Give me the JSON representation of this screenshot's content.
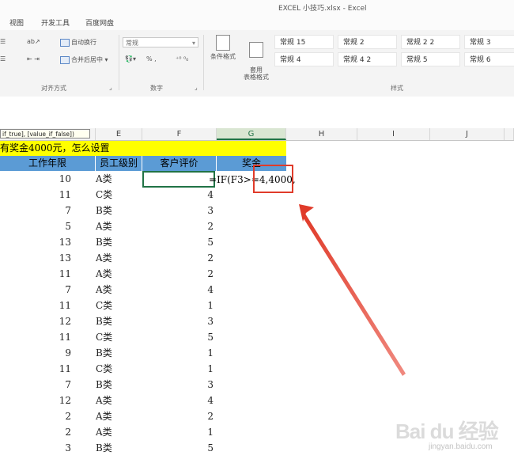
{
  "window": {
    "title": "EXCEL 小技巧.xlsx - Excel"
  },
  "menu": {
    "items": [
      "视图",
      "开发工具",
      "百度网盘"
    ]
  },
  "ribbon": {
    "wrap_text": "自动换行",
    "merge_center": "合并后居中",
    "number_format": "常规",
    "number_symbols": "% ,",
    "conditional_format": "条件格式",
    "format_as_table": "套用\n表格格式",
    "groups": {
      "alignment": "对齐方式",
      "number": "数字",
      "styles": "样式"
    },
    "styles": [
      "常规 15",
      "常规 2",
      "常规 2 2",
      "常规 3",
      "常规 4",
      "常规 4 2",
      "常规 5",
      "常规 6"
    ]
  },
  "tooltip": {
    "text": "if_true], [value_if_false])"
  },
  "columns": [
    "E",
    "F",
    "G",
    "H",
    "I",
    "J"
  ],
  "sheet": {
    "title": "有奖金4000元，怎么设置",
    "headers": [
      "工作年限",
      "员工级别",
      "客户评价",
      "奖金"
    ],
    "formula": "=IF(F3>=4,4000,",
    "rows": [
      {
        "years": "10",
        "level": "A类",
        "rating": ""
      },
      {
        "years": "11",
        "level": "C类",
        "rating": "4"
      },
      {
        "years": "7",
        "level": "B类",
        "rating": "3"
      },
      {
        "years": "5",
        "level": "A类",
        "rating": "2"
      },
      {
        "years": "13",
        "level": "B类",
        "rating": "5"
      },
      {
        "years": "13",
        "level": "A类",
        "rating": "2"
      },
      {
        "years": "11",
        "level": "A类",
        "rating": "2"
      },
      {
        "years": "7",
        "level": "A类",
        "rating": "4"
      },
      {
        "years": "11",
        "level": "C类",
        "rating": "1"
      },
      {
        "years": "12",
        "level": "B类",
        "rating": "3"
      },
      {
        "years": "11",
        "level": "C类",
        "rating": "5"
      },
      {
        "years": "9",
        "level": "B类",
        "rating": "1"
      },
      {
        "years": "11",
        "level": "C类",
        "rating": "1"
      },
      {
        "years": "7",
        "level": "B类",
        "rating": "3"
      },
      {
        "years": "12",
        "level": "A类",
        "rating": "4"
      },
      {
        "years": "2",
        "level": "A类",
        "rating": "2"
      },
      {
        "years": "2",
        "level": "A类",
        "rating": "1"
      },
      {
        "years": "3",
        "level": "B类",
        "rating": "5"
      }
    ]
  },
  "colors": {
    "title_fill": "#ffff00",
    "header_fill": "#5b9bd5",
    "annotation": "#e03b2a",
    "selection": "#217346"
  },
  "watermark": {
    "brand": "Bai du 经验",
    "url": "jingyan.baidu.com"
  }
}
